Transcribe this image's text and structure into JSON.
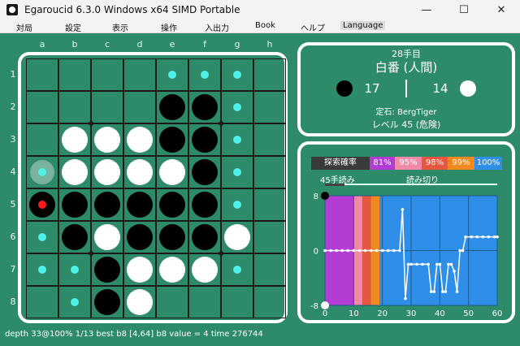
{
  "window": {
    "title": "Egaroucid 6.3.0 Windows x64 SIMD Portable"
  },
  "menu": [
    "対局",
    "設定",
    "表示",
    "操作",
    "入出力",
    "Book",
    "ヘルプ",
    "Language"
  ],
  "board": {
    "columns": [
      "a",
      "b",
      "c",
      "d",
      "e",
      "f",
      "g",
      "h"
    ],
    "rows": [
      "1",
      "2",
      "3",
      "4",
      "5",
      "6",
      "7",
      "8"
    ],
    "cells": [
      [
        "",
        "",
        "",
        "",
        "L",
        "L",
        "L",
        ""
      ],
      [
        "",
        "",
        "",
        "",
        "B",
        "B",
        "L",
        ""
      ],
      [
        "",
        "W",
        "W",
        "W",
        "B",
        "B",
        "L",
        ""
      ],
      [
        "G",
        "W",
        "W",
        "W",
        "W",
        "B",
        "L",
        ""
      ],
      [
        "X",
        "B",
        "B",
        "B",
        "B",
        "B",
        "L",
        ""
      ],
      [
        "L",
        "B",
        "W",
        "B",
        "B",
        "B",
        "W",
        ""
      ],
      [
        "L",
        "L",
        "B",
        "W",
        "W",
        "W",
        "L",
        ""
      ],
      [
        "",
        "L",
        "B",
        "W",
        "",
        "",
        "",
        ""
      ]
    ]
  },
  "info": {
    "move_number": "28手目",
    "turn": "白番 (人間)",
    "black_count": "17",
    "white_count": "14",
    "opening": "定石: BergTiger",
    "level": "レベル 45 (危険)"
  },
  "graph": {
    "legend_title": "探索確率",
    "legend": [
      {
        "label": "81%",
        "color": "#b23cd4"
      },
      {
        "label": "95%",
        "color": "#f08aa8"
      },
      {
        "label": "98%",
        "color": "#e5573e"
      },
      {
        "label": "99%",
        "color": "#f08a1e"
      },
      {
        "label": "100%",
        "color": "#2f8fe8"
      }
    ],
    "read_label": "45手読み",
    "endgame_label": "読み切り"
  },
  "chart_data": {
    "type": "line",
    "xlim": [
      0,
      60
    ],
    "ylim": [
      -8,
      8
    ],
    "x_ticks": [
      "0",
      "10",
      "20",
      "30",
      "40",
      "50",
      "60"
    ],
    "y_ticks": [
      "8",
      "0",
      "-8"
    ],
    "bands": [
      {
        "from": 0,
        "to": 10,
        "color": "#b23cd4"
      },
      {
        "from": 10,
        "to": 13,
        "color": "#f08aa8"
      },
      {
        "from": 13,
        "to": 16,
        "color": "#e5573e"
      },
      {
        "from": 16,
        "to": 19,
        "color": "#f08a1e"
      },
      {
        "from": 19,
        "to": 60,
        "color": "#2f8fe8"
      }
    ],
    "series": [
      {
        "points": [
          [
            0,
            0
          ],
          [
            2,
            0
          ],
          [
            4,
            0
          ],
          [
            6,
            0
          ],
          [
            8,
            0
          ],
          [
            10,
            0
          ],
          [
            12,
            0
          ],
          [
            14,
            0
          ],
          [
            16,
            0
          ],
          [
            18,
            0
          ],
          [
            20,
            0
          ],
          [
            22,
            0
          ],
          [
            24,
            0
          ],
          [
            26,
            0
          ],
          [
            27,
            6
          ],
          [
            28,
            -7
          ],
          [
            29,
            -2
          ],
          [
            30,
            -2
          ],
          [
            32,
            -2
          ],
          [
            34,
            -2
          ],
          [
            36,
            -2
          ],
          [
            37,
            -6
          ],
          [
            38,
            -6
          ],
          [
            39,
            -2
          ],
          [
            40,
            -2
          ],
          [
            41,
            -6
          ],
          [
            42,
            -6
          ],
          [
            43,
            -2
          ],
          [
            44,
            -2
          ],
          [
            45,
            -3
          ],
          [
            46,
            -6
          ],
          [
            47,
            0
          ],
          [
            48,
            0
          ],
          [
            49,
            2
          ],
          [
            51,
            2
          ],
          [
            53,
            2
          ],
          [
            55,
            2
          ],
          [
            57,
            2
          ],
          [
            59,
            2
          ],
          [
            60,
            2
          ]
        ]
      }
    ],
    "grid": true
  },
  "status": "depth 33@100% 1/13 best b8 [4,64] b8 value = 4 time 276744",
  "colors": {
    "background": "#2e8b6a",
    "legal_marker": "#4ef0e8",
    "last_move": "#ff1a1a"
  }
}
